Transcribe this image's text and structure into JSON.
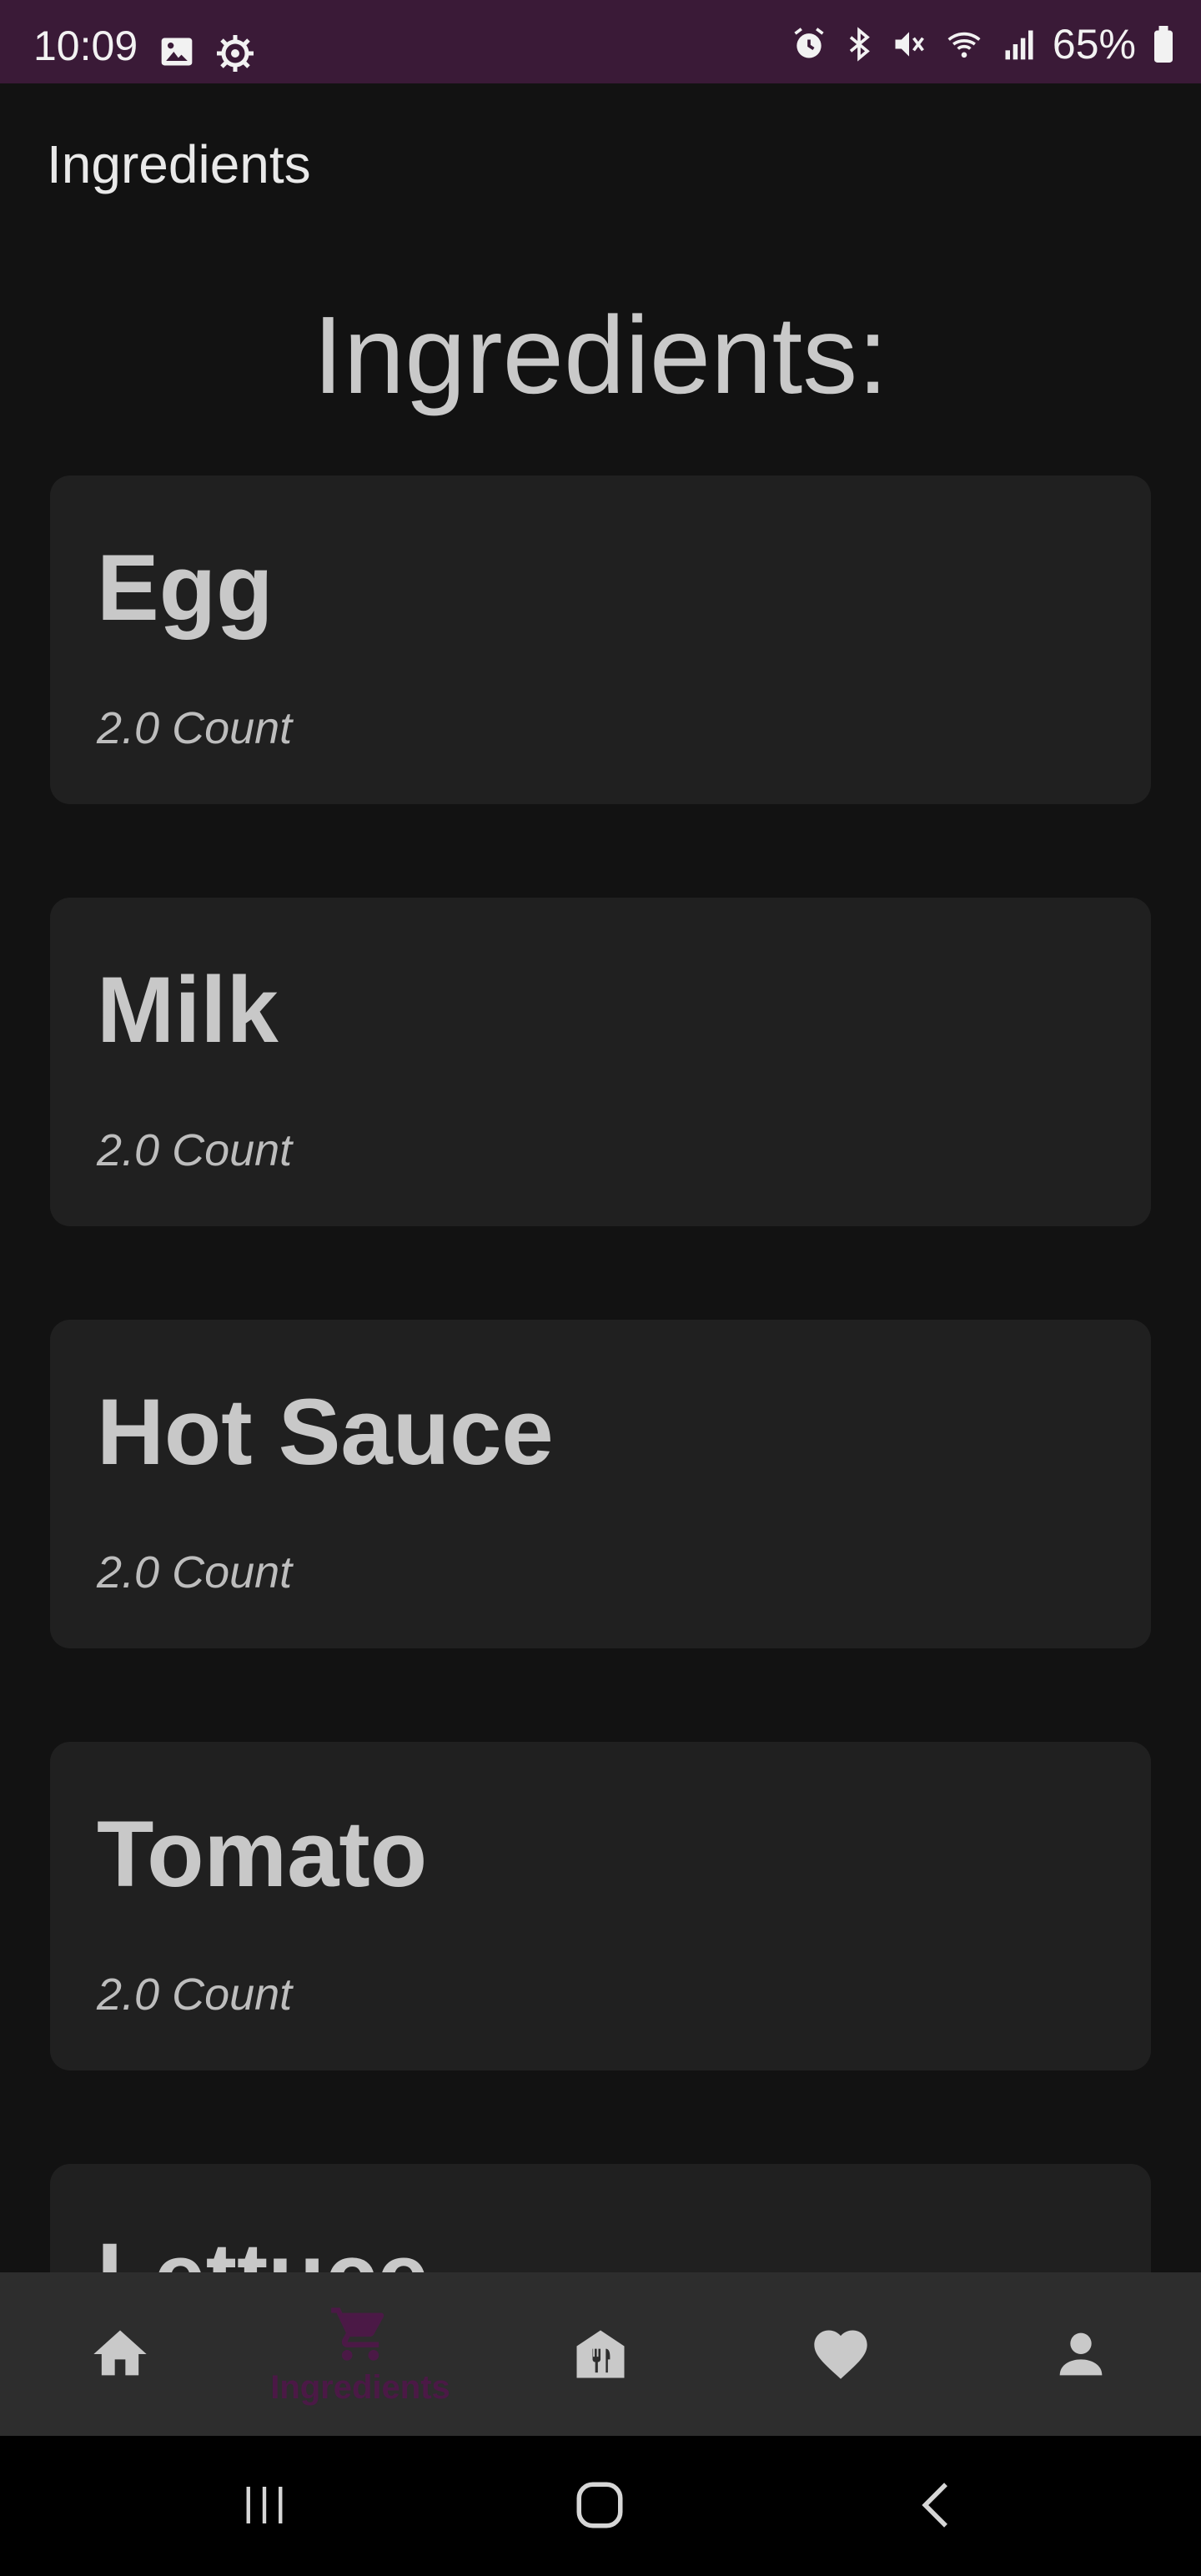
{
  "status_bar": {
    "time": "10:09",
    "battery": "65%",
    "icons": [
      "gallery-icon",
      "settings-icon",
      "alarm-icon",
      "bluetooth-icon",
      "mute-icon",
      "wifi-icon",
      "signal-icon",
      "battery-icon"
    ]
  },
  "app_bar": {
    "title": "Ingredients"
  },
  "page": {
    "heading": "Ingredients:"
  },
  "ingredients": [
    {
      "name": "Egg",
      "quantity": "2.0 Count"
    },
    {
      "name": "Milk",
      "quantity": "2.0 Count"
    },
    {
      "name": "Hot Sauce",
      "quantity": "2.0 Count"
    },
    {
      "name": "Tomato",
      "quantity": "2.0 Count"
    },
    {
      "name": "Lettuce",
      "quantity": ""
    }
  ],
  "bottom_nav": {
    "items": [
      {
        "icon": "home-icon",
        "label": ""
      },
      {
        "icon": "cart-icon",
        "label": "Ingredients",
        "active": true
      },
      {
        "icon": "restaurant-icon",
        "label": ""
      },
      {
        "icon": "heart-icon",
        "label": ""
      },
      {
        "icon": "person-icon",
        "label": ""
      }
    ],
    "active_color": "#4b1946",
    "inactive_color": "#c9c9c9"
  },
  "colors": {
    "status_bar": "#3a1a37",
    "background": "#121212",
    "card": "#202020",
    "nav": "#2d2d2d"
  }
}
